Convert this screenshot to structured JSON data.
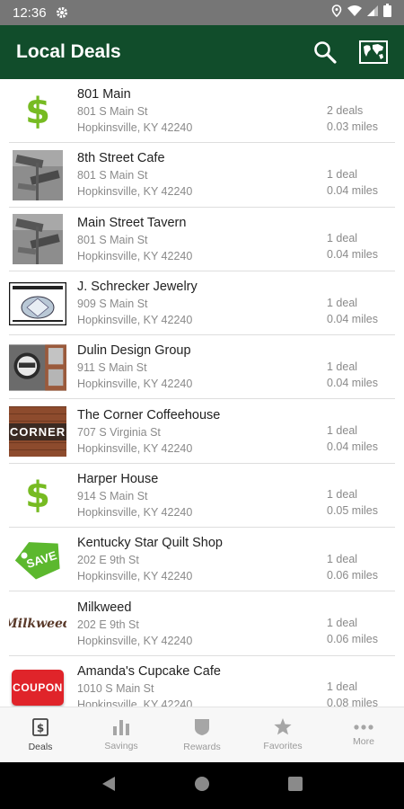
{
  "status_bar": {
    "time": "12:36"
  },
  "app_bar": {
    "title": "Local Deals"
  },
  "deals": [
    {
      "name": "801 Main",
      "street": "801 S Main St",
      "city": "Hopkinsville, KY 42240",
      "deals": "2 deals",
      "distance": "0.03 miles",
      "thumb": "dollar"
    },
    {
      "name": "8th Street Cafe",
      "street": "801 S Main St",
      "city": "Hopkinsville, KY 42240",
      "deals": "1 deal",
      "distance": "0.04 miles",
      "thumb": "street-sign"
    },
    {
      "name": "Main Street Tavern",
      "street": "801 S Main St",
      "city": "Hopkinsville, KY 42240",
      "deals": "1 deal",
      "distance": "0.04 miles",
      "thumb": "street-sign"
    },
    {
      "name": "J. Schrecker Jewelry",
      "street": "909 S Main St",
      "city": "Hopkinsville, KY 42240",
      "deals": "1 deal",
      "distance": "0.04 miles",
      "thumb": "jewelry"
    },
    {
      "name": "Dulin Design Group",
      "street": "911 S Main St",
      "city": "Hopkinsville, KY 42240",
      "deals": "1 deal",
      "distance": "0.04 miles",
      "thumb": "storefront"
    },
    {
      "name": "The Corner Coffeehouse",
      "street": "707 S Virginia St",
      "city": "Hopkinsville, KY 42240",
      "deals": "1 deal",
      "distance": "0.04 miles",
      "thumb": "corner"
    },
    {
      "name": "Harper House",
      "street": "914 S Main St",
      "city": "Hopkinsville, KY 42240",
      "deals": "1 deal",
      "distance": "0.05 miles",
      "thumb": "dollar"
    },
    {
      "name": "Kentucky Star Quilt Shop",
      "street": "202 E 9th St",
      "city": "Hopkinsville, KY 42240",
      "deals": "1 deal",
      "distance": "0.06 miles",
      "thumb": "save-tag"
    },
    {
      "name": "Milkweed",
      "street": "202 E 9th St",
      "city": "Hopkinsville, KY 42240",
      "deals": "1 deal",
      "distance": "0.06 miles",
      "thumb": "milkweed"
    },
    {
      "name": "Amanda's Cupcake Cafe",
      "street": "1010 S Main St",
      "city": "Hopkinsville, KY 42240",
      "deals": "1 deal",
      "distance": "0.08 miles",
      "thumb": "coupon"
    }
  ],
  "thumb_text": {
    "dollar": "$",
    "corner": "CORNER",
    "save": "SAVE",
    "milkweed": "Milkweed",
    "coupon": "COUPON"
  },
  "bottom_nav": [
    {
      "label": "Deals",
      "icon": "deals-icon",
      "active": true
    },
    {
      "label": "Savings",
      "icon": "savings-icon",
      "active": false
    },
    {
      "label": "Rewards",
      "icon": "rewards-icon",
      "active": false
    },
    {
      "label": "Favorites",
      "icon": "favorites-icon",
      "active": false
    },
    {
      "label": "More",
      "icon": "more-icon",
      "active": false
    }
  ],
  "colors": {
    "app_bar": "#114d2b",
    "dollar": "#77bb22",
    "status_bar": "#767676"
  }
}
